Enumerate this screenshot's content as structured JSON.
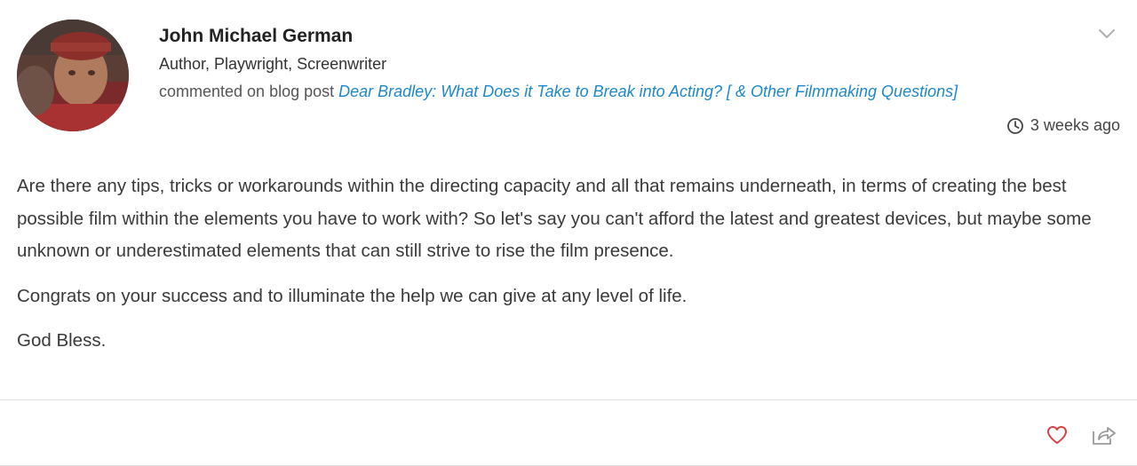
{
  "post": {
    "author": {
      "name": "John Michael German",
      "title": "Author, Playwright, Screenwriter",
      "avatar_icon": "user-avatar"
    },
    "activity": {
      "prefix": "commented on blog post",
      "link_text": "Dear Bradley: What Does it Take to Break into Acting? [ & Other Filmmaking Questions]"
    },
    "timestamp": "3 weeks ago",
    "body": [
      "Are there any tips, tricks or workarounds within the directing capacity and all that remains underneath, in terms of creating the best possible film within the elements you have to work with? So let's say you can't afford the latest and greatest devices, but maybe some unknown or underestimated elements that can still strive to rise the film presence.",
      "Congrats on your success and to illuminate the help we can give at any level of life.",
      "God Bless."
    ],
    "icons": {
      "menu": "chevron-down-icon",
      "time": "clock-icon",
      "like": "heart-icon",
      "share": "share-icon"
    },
    "colors": {
      "link": "#1e88c8",
      "like": "#d64545",
      "muted": "#9a9a9a"
    }
  }
}
